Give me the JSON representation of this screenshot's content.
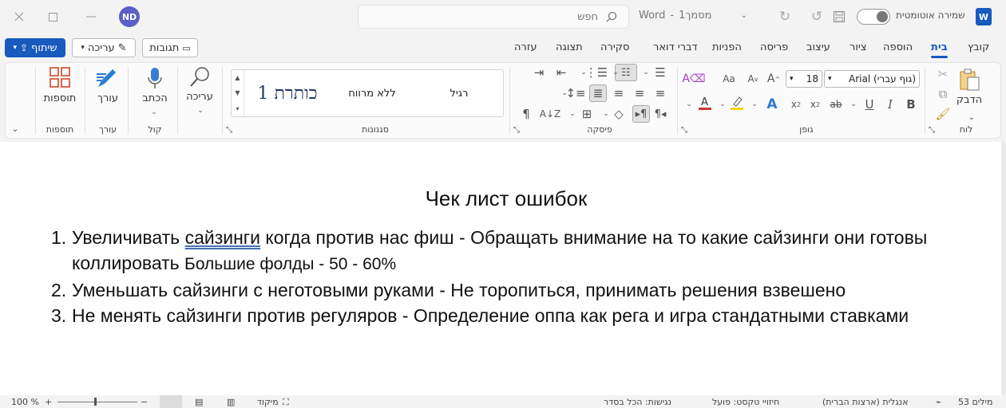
{
  "titlebar": {
    "avatar_initials": "ND",
    "search_placeholder": "חפש",
    "app_name": "Word",
    "doc_name": "מסמך1",
    "autosave_label": "שמירה אוטומטית",
    "word_logo": "W",
    "accent_color": "#185abd"
  },
  "menubar": {
    "share_label": "שיתוף",
    "editing_label": "עריכה",
    "comments_label": "תגובות",
    "tabs": [
      "קובץ",
      "בית",
      "הוספה",
      "ציור",
      "עיצוב",
      "פריסה",
      "הפניות",
      "דברי דואר",
      "סקירה",
      "תצוגה",
      "עזרה"
    ],
    "active_tab": "בית"
  },
  "ribbon": {
    "groups": {
      "clipboard": "לוח",
      "font": "גופן",
      "paragraph": "פיסקה",
      "styles": "סגנונות",
      "voice": "קול",
      "editor": "עורך",
      "addins": "תוספות"
    },
    "paste_label": "הדבק",
    "font_name": "Arial (גוף עברי)",
    "font_size": "18",
    "styles": [
      "רגיל",
      "ללא מרווח",
      "כותרת 1"
    ],
    "editing_button": "עריכה",
    "dictate_button": "הכתב",
    "editor_button": "עורך",
    "addins_button": "תוספות",
    "font_color": "#d13438",
    "highlight_color": "#f2d600"
  },
  "document": {
    "title": "Чек лист ошибок",
    "items": [
      {
        "num": "1.",
        "pre": "Увеличивать ",
        "underlined": "сайзинги",
        "post": " когда против нас фиш - Обращать внимание на то какие сайзинги они готовы коллировать ",
        "small": "Большие фолды - 50 - 60%"
      },
      {
        "num": "2.",
        "text": "Уменьшать сайзинги с неготовыми руками - Не торопиться, принимать решения взвешено"
      },
      {
        "num": "3.",
        "text": "Не менять сайзинги против регуляров - Определение оппа как рега и игра стандатными ставками"
      }
    ]
  },
  "statusbar": {
    "words": "53 מילים",
    "language": "אנגלית (ארצות הברית)",
    "text_predictions": "חיזויי טקסט: פועל",
    "accessibility": "נגישות: הכל בסדר",
    "focus": "מיקוד",
    "zoom": "100 %"
  }
}
